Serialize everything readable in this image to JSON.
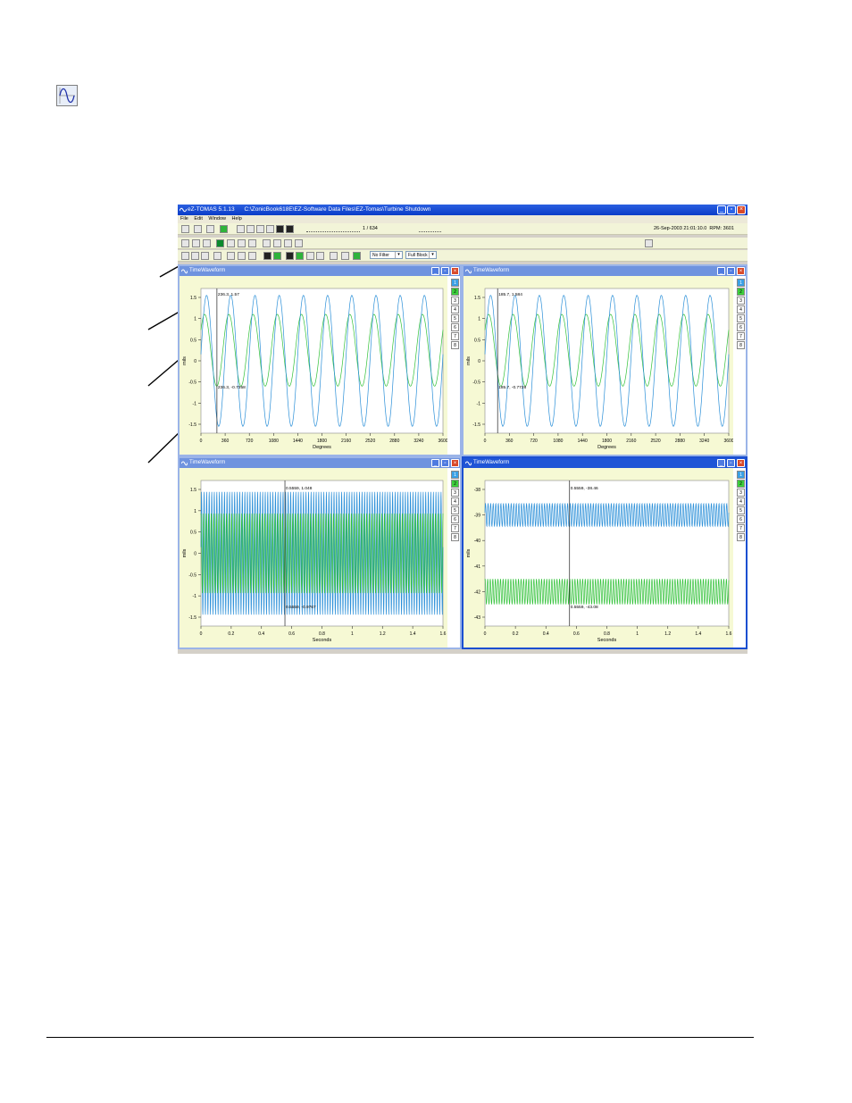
{
  "app": {
    "title": "eZ-TOMAS 5.1.13      C:\\ZonicBook618E\\EZ-Software Data Files\\EZ-Tomas\\Turbine Shutdown",
    "menu": [
      "File",
      "Edit",
      "Window",
      "Help"
    ],
    "frame_counter": "1 / 634",
    "status": "26-Sep-2003 21:01:10.0  RPM: 3601",
    "filter": "No Filter",
    "block": "Full Block"
  },
  "windows": [
    {
      "title": "TimeWaveform",
      "ylabel": "mils",
      "xlabel": "Degrees",
      "yticks": [
        "1.5",
        "1",
        "0.5",
        "0",
        "-0.5",
        "-1",
        "-1.5"
      ],
      "xticks": [
        "0",
        "360",
        "720",
        "1080",
        "1440",
        "1800",
        "2160",
        "2520",
        "2880",
        "3240",
        "3600"
      ],
      "cursor_labels": [
        "236.3, 1.57",
        "236.3, -0.7358"
      ],
      "channels": [
        "1",
        "2",
        "3",
        "4",
        "5",
        "6",
        "7",
        "8"
      ]
    },
    {
      "title": "TimeWaveform",
      "ylabel": "mils",
      "xlabel": "Degrees",
      "yticks": [
        "1.5",
        "1",
        "0.5",
        "0",
        "-0.5",
        "-1",
        "-1.5"
      ],
      "xticks": [
        "0",
        "360",
        "720",
        "1080",
        "1440",
        "1800",
        "2160",
        "2520",
        "2880",
        "3240",
        "3600"
      ],
      "cursor_labels": [
        "185.7, 1.584",
        "185.7, -0.7728"
      ],
      "channels": [
        "1",
        "2",
        "3",
        "4",
        "5",
        "6",
        "7",
        "8"
      ]
    },
    {
      "title": "TimeWaveform",
      "ylabel": "mils",
      "xlabel": "Seconds",
      "yticks": [
        "1.5",
        "1",
        "0.5",
        "0",
        "-0.5",
        "-1",
        "-1.5"
      ],
      "xticks": [
        "0",
        "0.2",
        "0.4",
        "0.6",
        "0.8",
        "1",
        "1.2",
        "1.4",
        "1.6"
      ],
      "cursor_labels": [
        "0.5559, 1.048",
        "0.5559, -0.9767"
      ],
      "channels": [
        "1",
        "2",
        "3",
        "4",
        "5",
        "6",
        "7",
        "8"
      ]
    },
    {
      "title": "TimeWaveform",
      "ylabel": "mils",
      "xlabel": "Seconds",
      "yticks": [
        "-38",
        "-39",
        "-40",
        "-41",
        "-42",
        "-43"
      ],
      "xticks": [
        "0",
        "0.2",
        "0.4",
        "0.6",
        "0.8",
        "1",
        "1.2",
        "1.4",
        "1.6"
      ],
      "cursor_labels": [
        "0.5559, -38.46",
        "0.5559, -43.08"
      ],
      "channels": [
        "1",
        "2",
        "3",
        "4",
        "5",
        "6",
        "7",
        "8"
      ]
    }
  ],
  "colors": {
    "ch1": "#2a8fd8",
    "ch2": "#33c23a",
    "plot_bg": "#f6f9d4"
  },
  "icons": [
    "waveform-icon"
  ]
}
